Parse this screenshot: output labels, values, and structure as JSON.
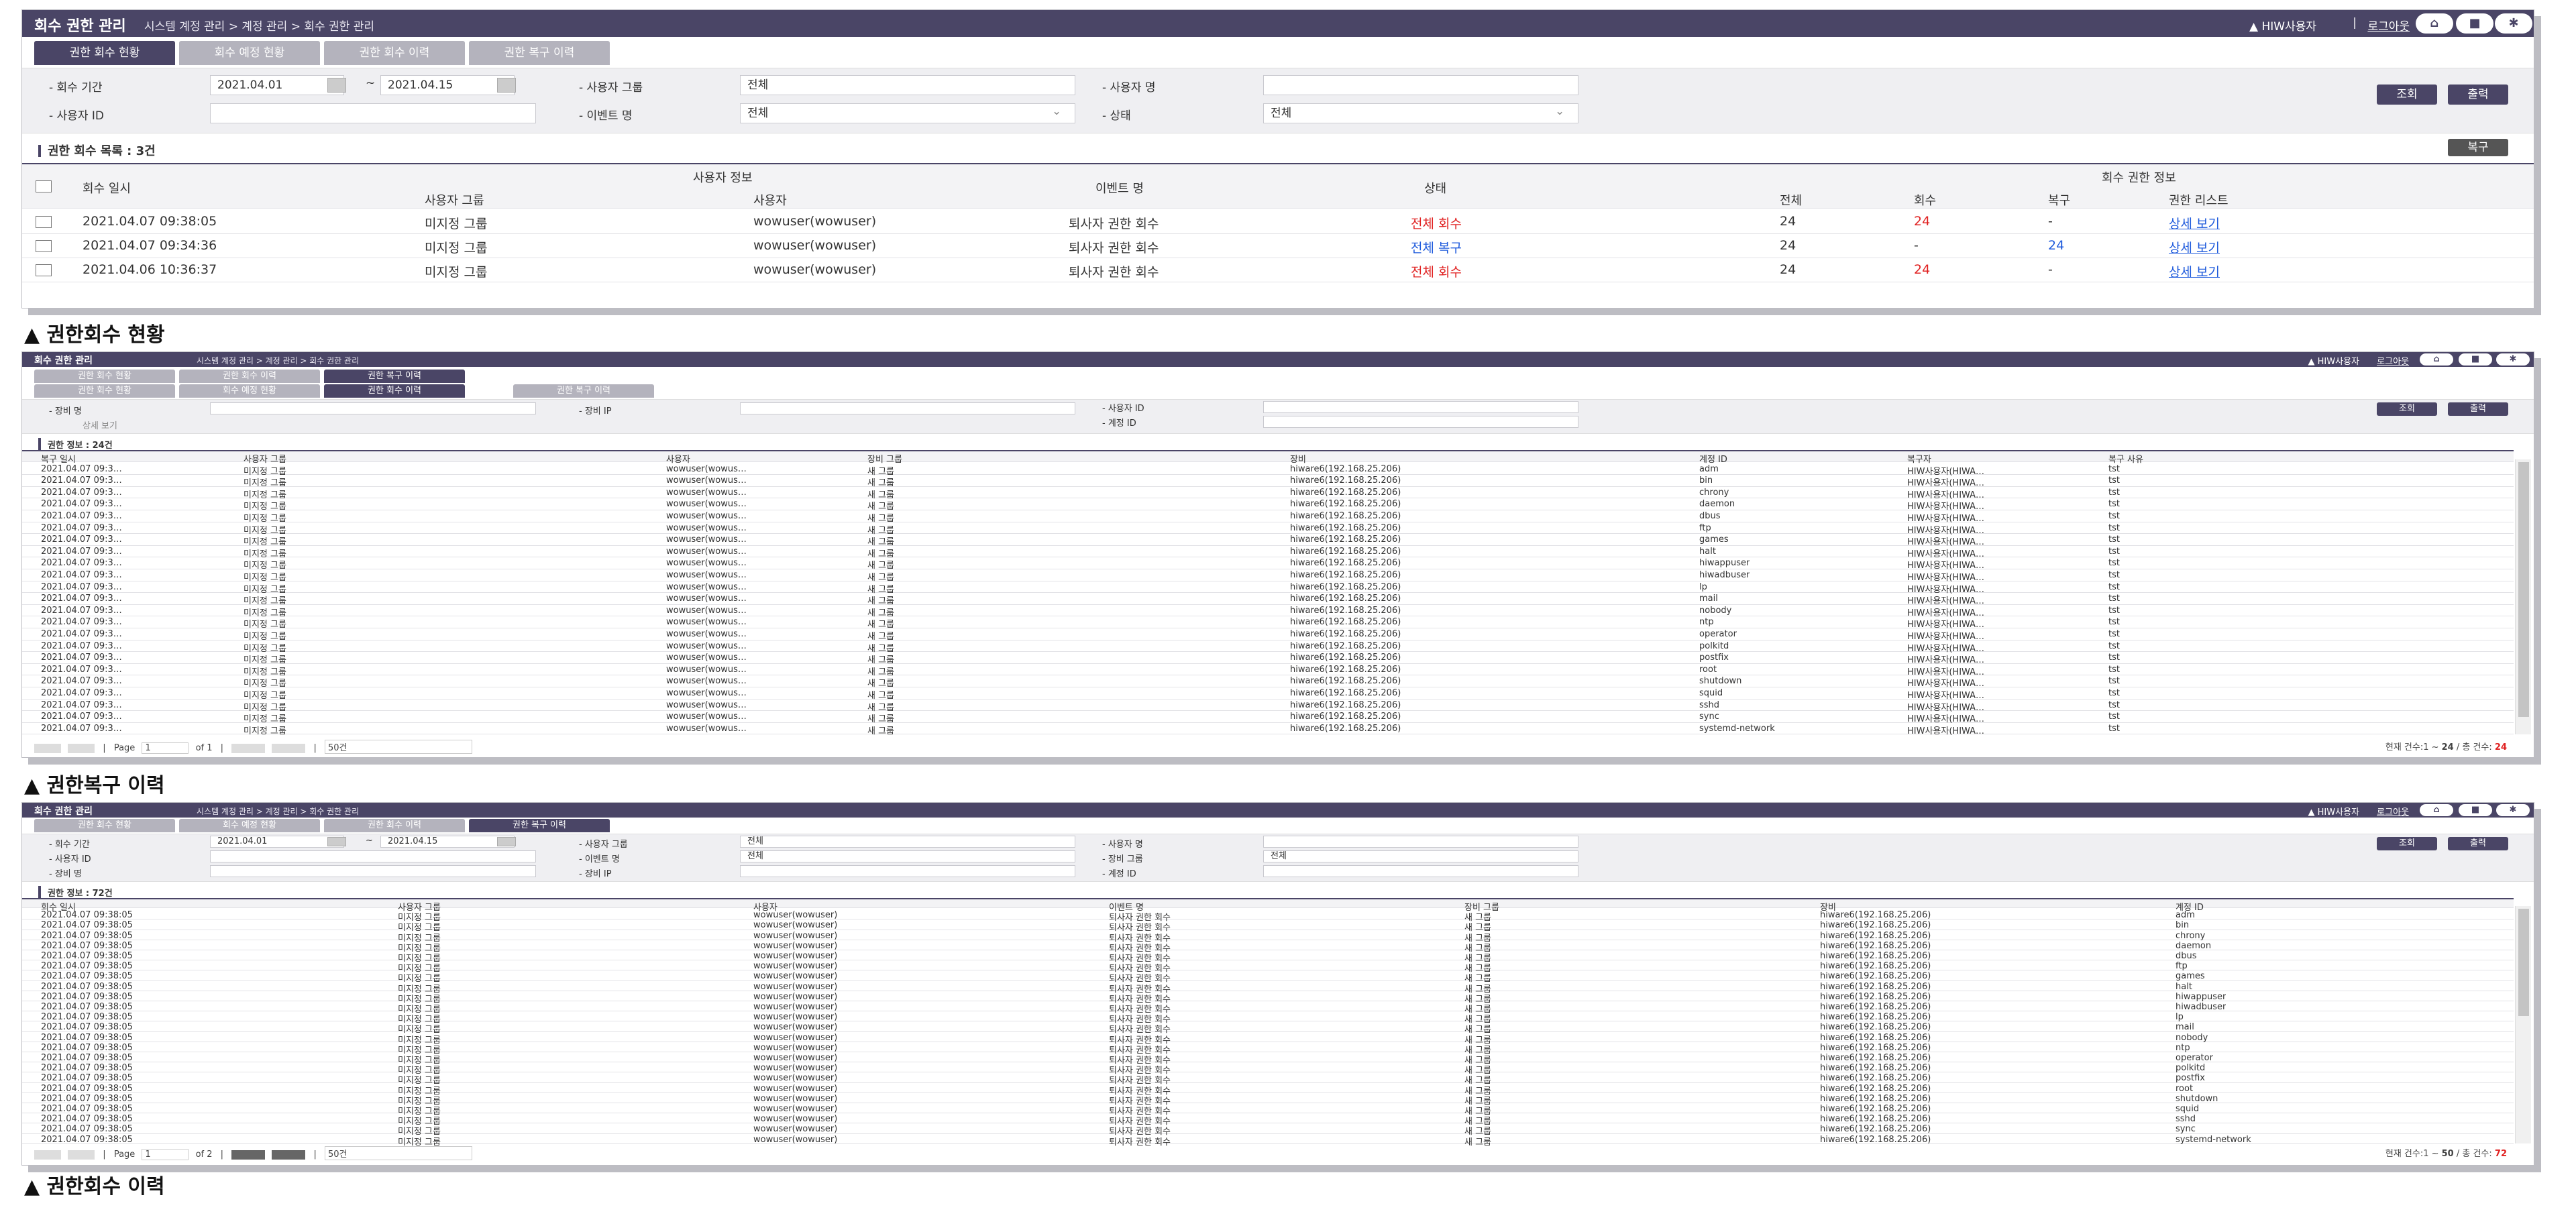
{
  "common": {
    "title": "회수 권한 관리",
    "breadcrumb": "시스템 계정 관리 > 계정 관리 > 회수 권한 관리",
    "user": "HIW사용자",
    "logout": "로그아웃",
    "search_btn": "조회",
    "export_btn": "출력",
    "brand_color": "#4a4566",
    "icons": [
      "home-icon",
      "lock-icon",
      "settings-icon"
    ]
  },
  "panel1": {
    "tabs": [
      "권한 회수 현황",
      "회수 예정 현황",
      "권한 회수 이력",
      "권한 복구 이력"
    ],
    "search": {
      "period_label": "- 회수 기간",
      "date_from": "2021.04.01",
      "date_to": "2021.04.15",
      "group_label": "- 사용자 그룹",
      "group_value": "전체",
      "name_label": "- 사용자 명",
      "userid_label": "- 사용자 ID",
      "event_label": "- 이벤트 명",
      "event_value": "전체",
      "status_label": "- 상태",
      "status_value": "전체"
    },
    "list_title": "권한 회수 목록 : 3건",
    "restore_btn": "복구",
    "headers": {
      "date": "회수 일시",
      "user_info": "사용자 정보",
      "user_group": "사용자 그룹",
      "user": "사용자",
      "event": "이벤트 명",
      "status": "상태",
      "revoke_info": "회수 권한 정보",
      "total": "전체",
      "revoked": "회수",
      "restored": "복구",
      "perm_list": "권한 리스트"
    },
    "rows": [
      {
        "date": "2021.04.07 09:38:05",
        "group": "미지정 그룹",
        "user": "wowuser(wowuser)",
        "event": "퇴사자 권한 회수",
        "status": "전체 회수",
        "total": "24",
        "revoked": "24",
        "restored": "-",
        "link": "상세 보기"
      },
      {
        "date": "2021.04.07 09:34:36",
        "group": "미지정 그룹",
        "user": "wowuser(wowuser)",
        "event": "퇴사자 권한 회수",
        "status": "전체 복구",
        "total": "24",
        "revoked": "-",
        "restored": "24",
        "link": "상세 보기"
      },
      {
        "date": "2021.04.06 10:36:37",
        "group": "미지정 그룹",
        "user": "wowuser(wowuser)",
        "event": "퇴사자 권한 회수",
        "status": "전체 회수",
        "total": "24",
        "revoked": "24",
        "restored": "-",
        "link": "상세 보기"
      }
    ],
    "caption": "▲ 권한회수 현황"
  },
  "panel2": {
    "tabs_row1": [
      "권한 회수 현황",
      "권한 회수 이력",
      "권한 복구 이력"
    ],
    "tabs_row2": [
      "권한 회수 현황",
      "회수 예정 현황",
      "권한 회수 이력",
      "권한 복구 이력"
    ],
    "search": {
      "equip_name_label": "- 장비 명",
      "equip_ip_label": "- 장비 IP",
      "userid_label": "- 사용자 ID",
      "account_label": "- 계정 ID",
      "detail": "상세 보기"
    },
    "list_title": "권한 정보 : 24건",
    "headers": [
      "복구 일시",
      "사용자 그룹",
      "사용자",
      "장비 그룹",
      "장비",
      "계정 ID",
      "복구자",
      "복구 사유"
    ],
    "row_common": {
      "date": "2021.04.07 09:3…",
      "group": "미지정 그룹",
      "user": "wowuser(wowus…",
      "equip_group": "새 그룹",
      "equip": "hiware6(192.168.25.206)",
      "restorer": "HIW사용자(HIWA…",
      "reason": "tst"
    },
    "accounts": [
      "adm",
      "bin",
      "chrony",
      "daemon",
      "dbus",
      "ftp",
      "games",
      "halt",
      "hiwappuser",
      "hiwadbuser",
      "lp",
      "mail",
      "nobody",
      "ntp",
      "operator",
      "polkitd",
      "postfix",
      "root",
      "shutdown",
      "squid",
      "sshd",
      "sync",
      "systemd-network"
    ],
    "pager": {
      "page_label": "Page",
      "page": "1",
      "of": "of 1",
      "size": "50건"
    },
    "summary_prefix": "현재 건수:1 ~ ",
    "summary_count": "24",
    "summary_mid": " / 총 건수: ",
    "summary_total": "24",
    "caption": "▲ 권한복구 이력"
  },
  "panel3": {
    "tabs": [
      "권한 회수 현황",
      "회수 예정 현황",
      "권한 회수 이력",
      "권한 복구 이력"
    ],
    "search": {
      "period_label": "- 회수 기간",
      "date_from": "2021.04.01",
      "date_to": "2021.04.15",
      "group_label": "- 사용자 그룹",
      "group_value": "전체",
      "name_label": "- 사용자 명",
      "userid_label": "- 사용자 ID",
      "event_label": "- 이벤트 명",
      "event_value": "전체",
      "equip_group_label": "- 장비 그룹",
      "equip_group_value": "전체",
      "equip_name_label": "- 장비 명",
      "equip_ip_label": "- 장비 IP",
      "account_label": "- 계정 ID"
    },
    "list_title": "권한 정보 : 72건",
    "headers": [
      "회수 일시",
      "사용자 그룹",
      "사용자",
      "이벤트 명",
      "장비 그룹",
      "장비",
      "계정 ID"
    ],
    "row_common": {
      "date": "2021.04.07 09:38:05",
      "group": "미지정 그룹",
      "user": "wowuser(wowuser)",
      "event": "퇴사자 권한 회수",
      "equip_group": "새 그룹",
      "equip": "hiware6(192.168.25.206)"
    },
    "accounts": [
      "adm",
      "bin",
      "chrony",
      "daemon",
      "dbus",
      "ftp",
      "games",
      "halt",
      "hiwappuser",
      "hiwadbuser",
      "lp",
      "mail",
      "nobody",
      "ntp",
      "operator",
      "polkitd",
      "postfix",
      "root",
      "shutdown",
      "squid",
      "sshd",
      "sync",
      "systemd-network"
    ],
    "pager": {
      "page_label": "Page",
      "page": "1",
      "of": "of 2",
      "size": "50건"
    },
    "summary_prefix": "현재 건수:1 ~ ",
    "summary_count": "50",
    "summary_mid": " / 총 건수: ",
    "summary_total": "72",
    "caption": "▲ 권한회수 이력"
  }
}
